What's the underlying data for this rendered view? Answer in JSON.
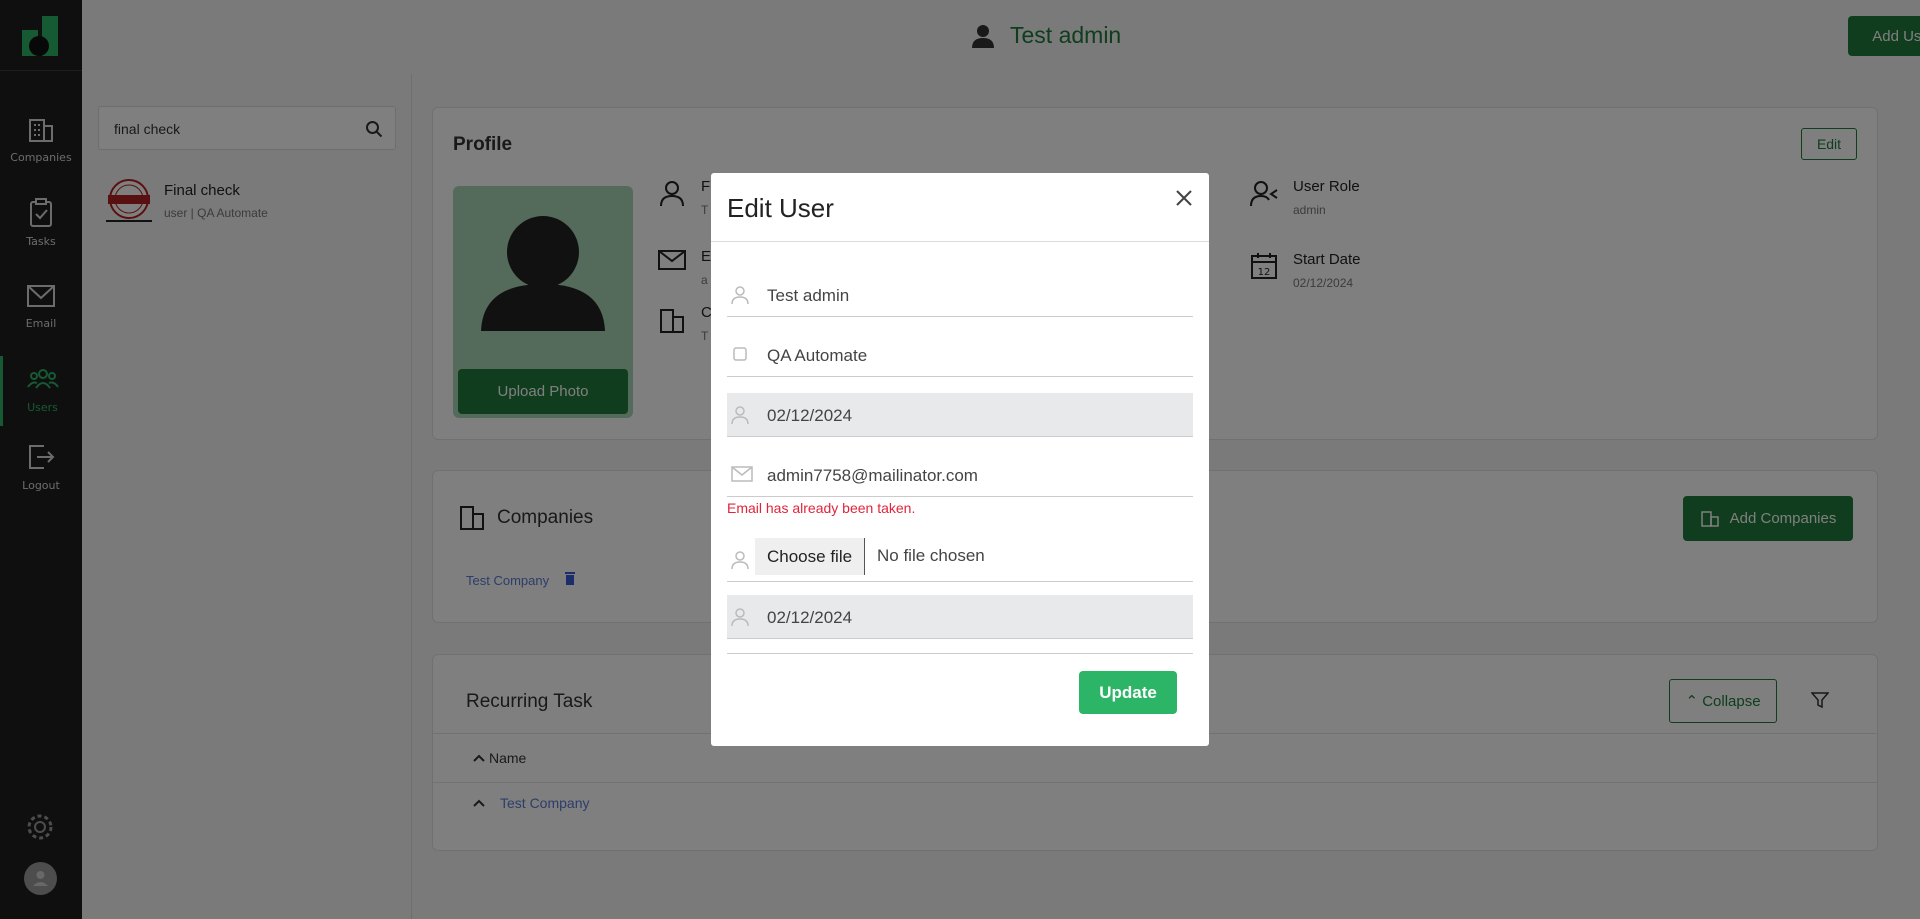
{
  "sidebar": {
    "items": [
      {
        "label": "Companies",
        "icon": "building-icon"
      },
      {
        "label": "Tasks",
        "icon": "clipboard-check-icon"
      },
      {
        "label": "Email",
        "icon": "envelope-icon"
      },
      {
        "label": "Users",
        "icon": "users-icon",
        "active": true
      },
      {
        "label": "Logout",
        "icon": "logout-icon"
      }
    ]
  },
  "header": {
    "user_name": "Test admin",
    "add_user_label": "Add User"
  },
  "search": {
    "value": "final check"
  },
  "user_list": [
    {
      "title": "Final check",
      "subtitle": "user | QA Automate"
    }
  ],
  "profile": {
    "title": "Profile",
    "edit_label": "Edit",
    "upload_label": "Upload Photo",
    "fields": {
      "name_label": "F",
      "name_value": "T",
      "email_label": "E",
      "email_value": "a",
      "company_label": "C",
      "company_value": "T",
      "role_label": "User Role",
      "role_value": "admin",
      "start_label": "Start Date",
      "start_value": "02/12/2024"
    }
  },
  "companies": {
    "title": "Companies",
    "add_label": "Add Companies",
    "items": [
      "Test Company"
    ]
  },
  "recurring": {
    "title": "Recurring Task",
    "collapse_label": "Collapse",
    "column_name": "Name",
    "rows": [
      "Test Company"
    ]
  },
  "modal": {
    "title": "Edit User",
    "name_value": "Test admin",
    "company_value": "QA Automate",
    "date1_value": "02/12/2024",
    "email_value": "admin7758@mailinator.com",
    "email_error": "Email has already been taken.",
    "file_button": "Choose file",
    "file_status": "No file chosen",
    "date2_value": "02/12/2024",
    "update_label": "Update"
  },
  "colors": {
    "brand_green": "#1e7a3a",
    "accent_green": "#2db567",
    "error_red": "#e0243c",
    "sidebar_bg": "#1f1f1f"
  }
}
